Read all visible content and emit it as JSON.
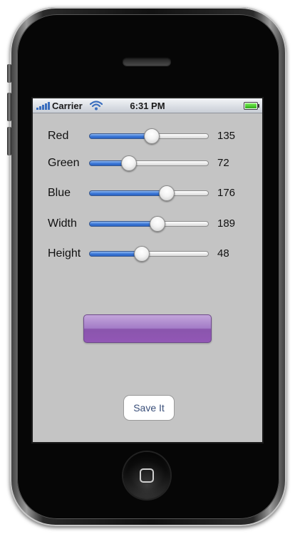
{
  "status_bar": {
    "carrier": "Carrier",
    "time": "6:31 PM",
    "signal_icon": "signal-bars-icon",
    "wifi_icon": "wifi-icon",
    "battery_icon": "battery-icon",
    "battery_level": 1.0
  },
  "sliders": [
    {
      "label": "Red",
      "value": "135",
      "fraction": 0.53
    },
    {
      "label": "Green",
      "value": "72",
      "fraction": 0.31
    },
    {
      "label": "Blue",
      "value": "176",
      "fraction": 0.67
    },
    {
      "label": "Width",
      "value": "189",
      "fraction": 0.58
    },
    {
      "label": "Height",
      "value": "48",
      "fraction": 0.43
    }
  ],
  "color_preview": {
    "color": "#8748b0"
  },
  "save_button": {
    "label": "Save It"
  },
  "colors": {
    "screen_background": "#c4c4c4",
    "slider_fill": "#3a76d6",
    "button_text": "#3a4f7a"
  }
}
